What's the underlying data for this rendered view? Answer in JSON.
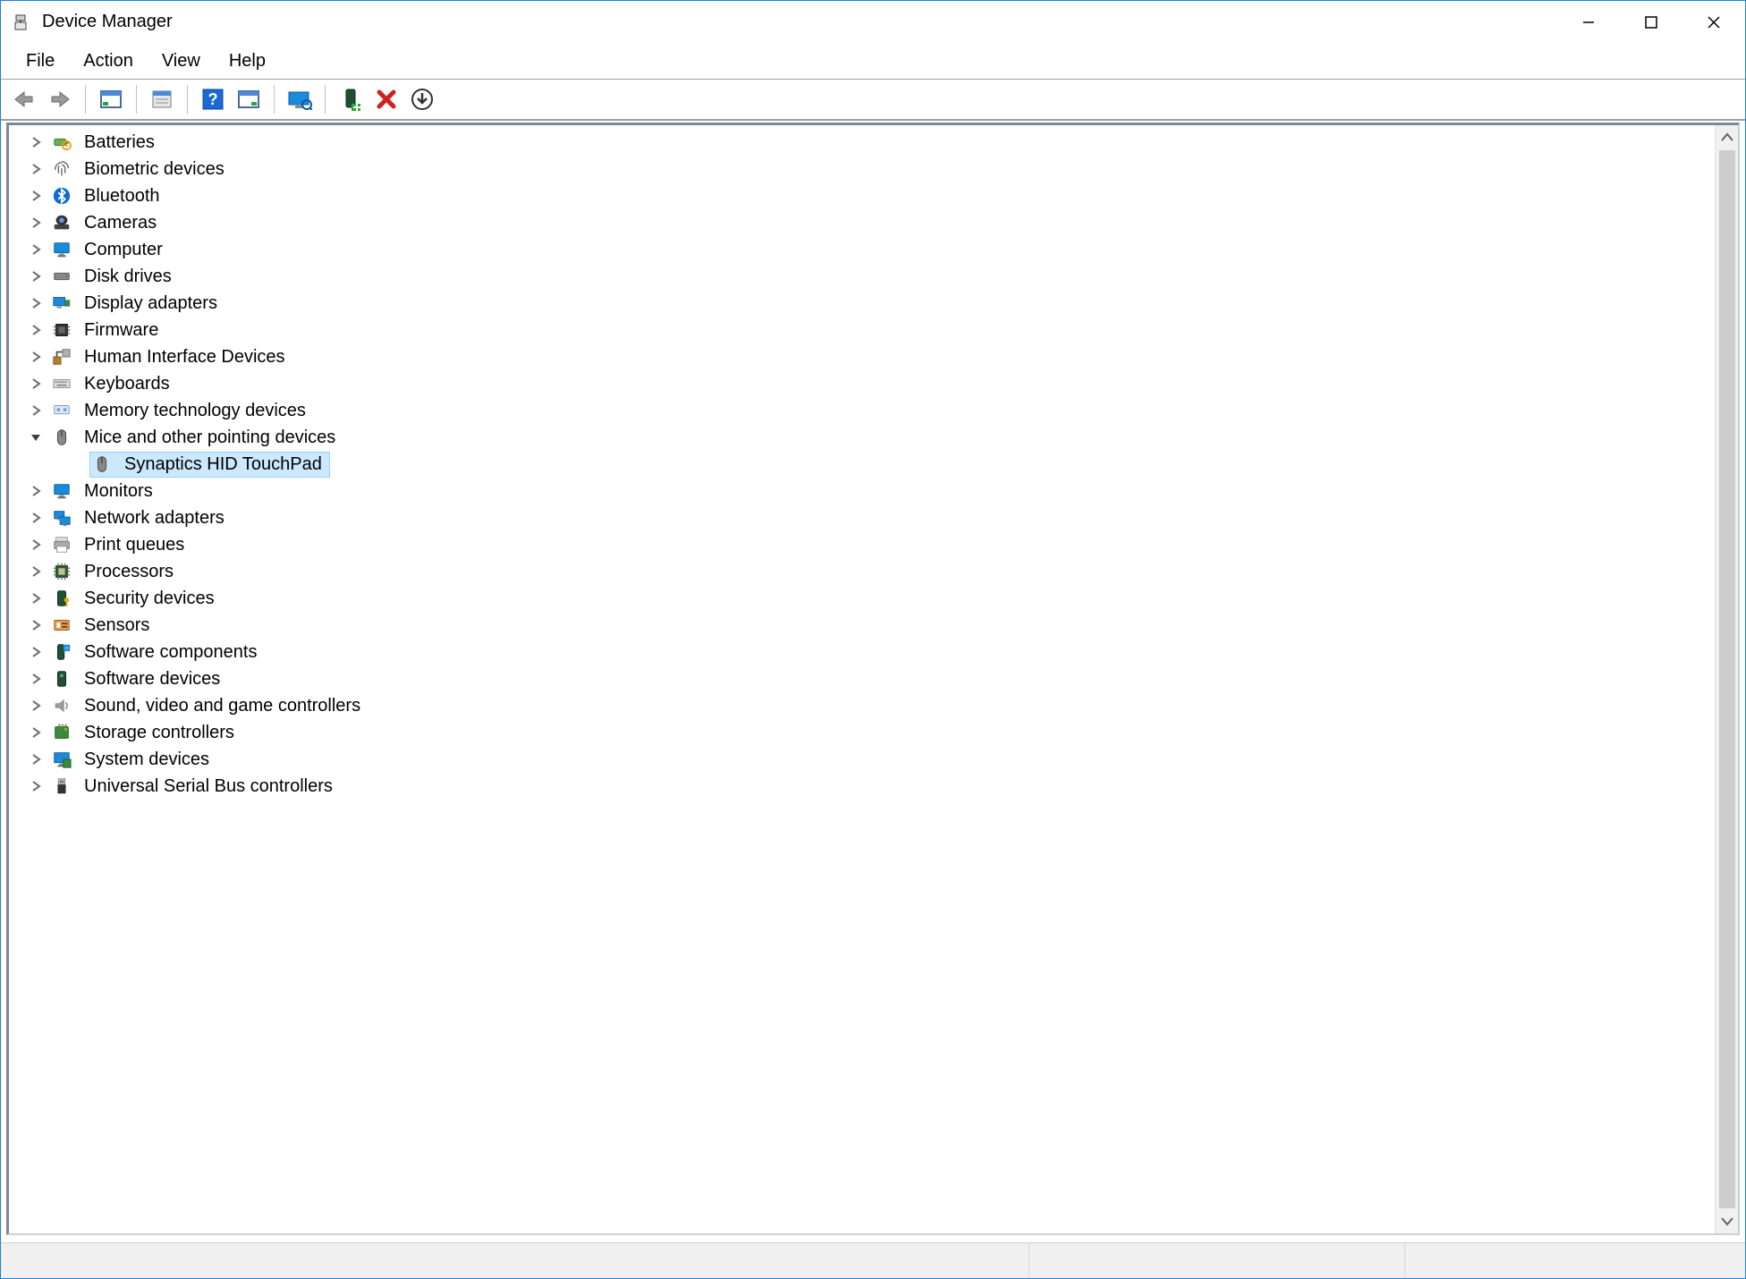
{
  "window": {
    "title": "Device Manager"
  },
  "menu": {
    "file": "File",
    "action": "Action",
    "view": "View",
    "help": "Help"
  },
  "toolbar": {
    "back": "Back",
    "forward": "Forward",
    "show_hide_tree": "Show/Hide Console Tree",
    "properties": "Properties",
    "help": "Help",
    "action_pane": "Show/Hide Action Pane",
    "scan_hardware": "Scan for hardware changes",
    "enable_device": "Enable Device",
    "uninstall_device": "Uninstall Device",
    "update_driver": "Update Device Driver"
  },
  "tree": {
    "nodes": [
      {
        "label": "Batteries",
        "icon": "battery"
      },
      {
        "label": "Biometric devices",
        "icon": "fingerprint"
      },
      {
        "label": "Bluetooth",
        "icon": "bluetooth"
      },
      {
        "label": "Cameras",
        "icon": "camera"
      },
      {
        "label": "Computer",
        "icon": "monitor"
      },
      {
        "label": "Disk drives",
        "icon": "disk"
      },
      {
        "label": "Display adapters",
        "icon": "display-adapter"
      },
      {
        "label": "Firmware",
        "icon": "chip"
      },
      {
        "label": "Human Interface Devices",
        "icon": "hid"
      },
      {
        "label": "Keyboards",
        "icon": "keyboard"
      },
      {
        "label": "Memory technology devices",
        "icon": "memory"
      },
      {
        "label": "Mice and other pointing devices",
        "icon": "mouse",
        "expanded": true,
        "children": [
          {
            "label": "Synaptics HID TouchPad",
            "icon": "mouse",
            "selected": true
          }
        ]
      },
      {
        "label": "Monitors",
        "icon": "monitor"
      },
      {
        "label": "Network adapters",
        "icon": "network"
      },
      {
        "label": "Print queues",
        "icon": "printer"
      },
      {
        "label": "Processors",
        "icon": "cpu"
      },
      {
        "label": "Security devices",
        "icon": "security"
      },
      {
        "label": "Sensors",
        "icon": "sensor"
      },
      {
        "label": "Software components",
        "icon": "sw-component"
      },
      {
        "label": "Software devices",
        "icon": "sw-device"
      },
      {
        "label": "Sound, video and game controllers",
        "icon": "speaker"
      },
      {
        "label": "Storage controllers",
        "icon": "storage"
      },
      {
        "label": "System devices",
        "icon": "system"
      },
      {
        "label": "Universal Serial Bus controllers",
        "icon": "usb"
      }
    ]
  }
}
